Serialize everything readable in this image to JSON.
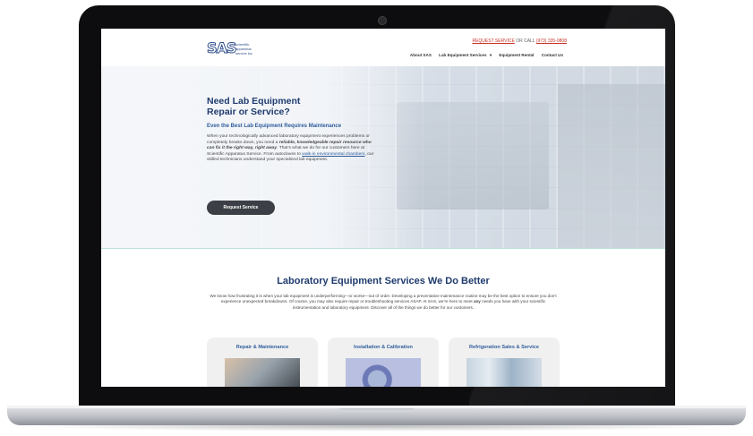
{
  "site": {
    "logo": {
      "mark": "SAS",
      "subtitle": "scientific apparatus service inc"
    },
    "topbar": {
      "request_link": "REQUEST SERVICE",
      "or_call": "OR CALL",
      "phone": "(973) 335-0808"
    },
    "nav": [
      "About SAS",
      "Lab Equipment Services",
      "Equipment Rental",
      "Contact Us"
    ],
    "nav_dropdown_icon": "▾",
    "hero": {
      "title": "Need Lab Equipment Repair or Service?",
      "subtitle": "Even the Best Lab Equipment Requires Maintenance",
      "body_intro": "When your technologically advanced laboratory equipment experiences problems or completely breaks down, you need a ",
      "body_emphasis": "reliable, knowledgeable repair resource who can fix it the right way, right away",
      "body_mid": ". That’s what we do for our customers here at Scientific Apparatus Service. From autoclaves to ",
      "body_link": "walk-in environmental chambers",
      "body_end": ", our skilled technicians understand your specialized lab equipment.",
      "button": "Request Service"
    },
    "services": {
      "title": "Laboratory Equipment Services We Do Better",
      "body_start": "We know how frustrating it is when your lab equipment is underperforming—or worse—out of order. Developing a preventative maintenance routine may be the best option to ensure you don’t experience unexpected breakdowns. Of course, you may also require repair or troubleshooting services ASAP. At SAS, we’re here to meet ",
      "body_bold": "any",
      "body_end": " needs you have with your scientific instrumentation and laboratory equipment. Discover all of the things we do better for our customers.",
      "cards": [
        {
          "title": "Repair & Maintenance"
        },
        {
          "title": "Installation & Calibration"
        },
        {
          "title": "Refrigeration Sales & Service"
        }
      ]
    }
  }
}
